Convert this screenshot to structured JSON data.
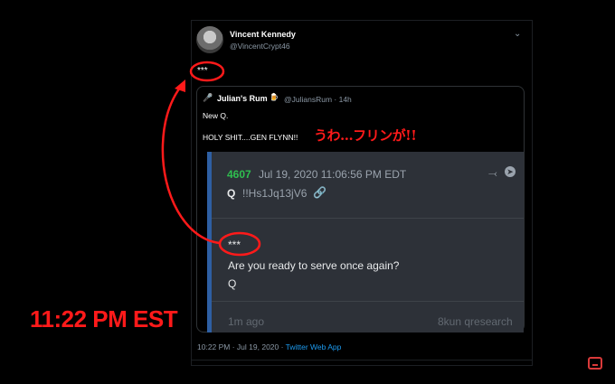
{
  "tweet": {
    "author_name": "Vincent Kennedy",
    "author_handle": "@VincentCrypt46",
    "text": "***",
    "timestamp": "10:22 PM · Jul 19, 2020 · ",
    "source_app": "Twitter Web App"
  },
  "quote": {
    "author_icon": "🎤",
    "author_name": "Julian's Rum",
    "author_emoji": "🍺",
    "handle_time": "@JuliansRum · 14h",
    "line1": "New Q.",
    "line2": "HOLY SHIT....GEN FLYNN!!"
  },
  "post": {
    "number": "4607",
    "date": "Jul 19, 2020 11:06:56 PM EDT",
    "poster": "Q",
    "tripcode": "!!Hs1Jq13jV6",
    "stars": "***",
    "body_line1": "Are you ready to serve once again?",
    "body_line2": "Q",
    "age": "1m ago",
    "board": "8kun qresearch"
  },
  "overlays": {
    "japanese": "うわ...フリンが!!",
    "time_note": "11:22 PM EST"
  },
  "icons": {
    "chevron": "chevron-down-icon",
    "share": "share-icon",
    "arrow": "arrow-right-icon",
    "link": "link-icon",
    "corner": "caption-icon"
  },
  "colors": {
    "annotation_red": "#ff1a1a",
    "post_number_green": "#2fbf4f",
    "link_blue": "#1d9bf0"
  }
}
